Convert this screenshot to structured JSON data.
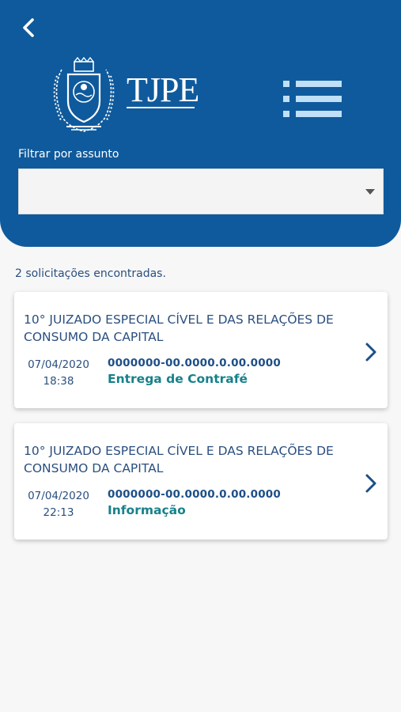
{
  "header": {
    "logo_text": "TJPE",
    "filter_label": "Filtrar por assunto",
    "filter_value": "",
    "colors": {
      "primary": "#0f5a9c",
      "menu_icon": "#bfe0f7"
    },
    "icons": {
      "back": "chevron-left-icon",
      "menu": "list-icon",
      "dropdown": "caret-down-icon"
    }
  },
  "results": {
    "count_text": "2 solicitações encontradas."
  },
  "cards": [
    {
      "title": "10° JUIZADO ESPECIAL CÍVEL E DAS RELAÇÕES DE CONSUMO DA CAPITAL",
      "date": "07/04/2020",
      "time": "18:38",
      "process": "0000000-00.0000.0.00.0000",
      "status": "Entrega de Contrafé"
    },
    {
      "title": "10° JUIZADO ESPECIAL CÍVEL E DAS RELAÇÕES DE CONSUMO DA CAPITAL",
      "date": "07/04/2020",
      "time": "22:13",
      "process": "0000000-00.0000.0.00.0000",
      "status": "Informação"
    }
  ]
}
